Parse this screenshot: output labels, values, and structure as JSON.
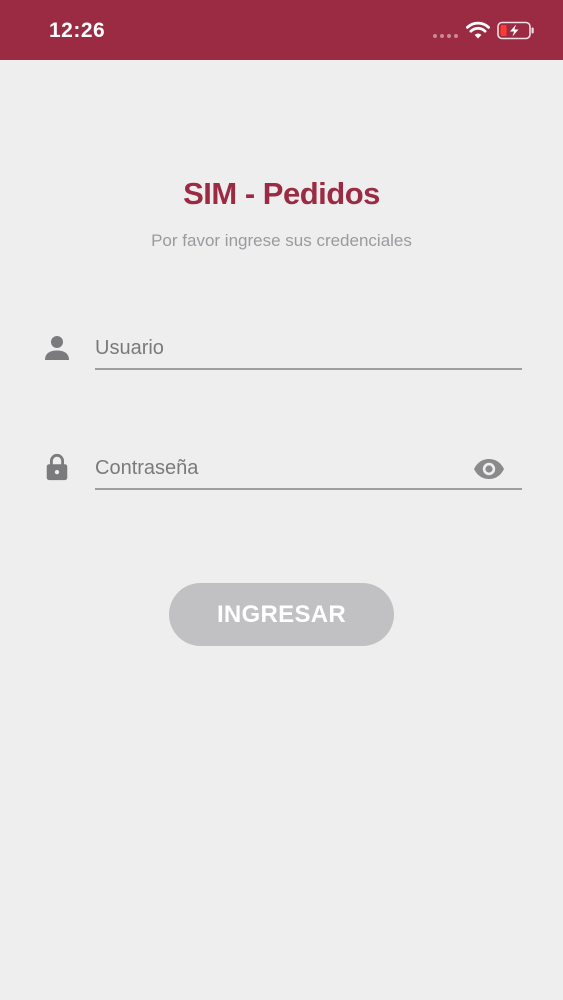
{
  "status_bar": {
    "time": "12:26",
    "background_color": "#9a2b43"
  },
  "header": {
    "title": "SIM - Pedidos",
    "subtitle": "Por favor ingrese sus credenciales",
    "title_color": "#9a2b43"
  },
  "form": {
    "username": {
      "placeholder": "Usuario",
      "value": "",
      "icon": "person-icon"
    },
    "password": {
      "placeholder": "Contraseña",
      "value": "",
      "icon": "lock-icon",
      "toggle_icon": "eye-icon"
    },
    "submit_label": "INGRESAR",
    "submit_color": "#c1c0c3"
  }
}
